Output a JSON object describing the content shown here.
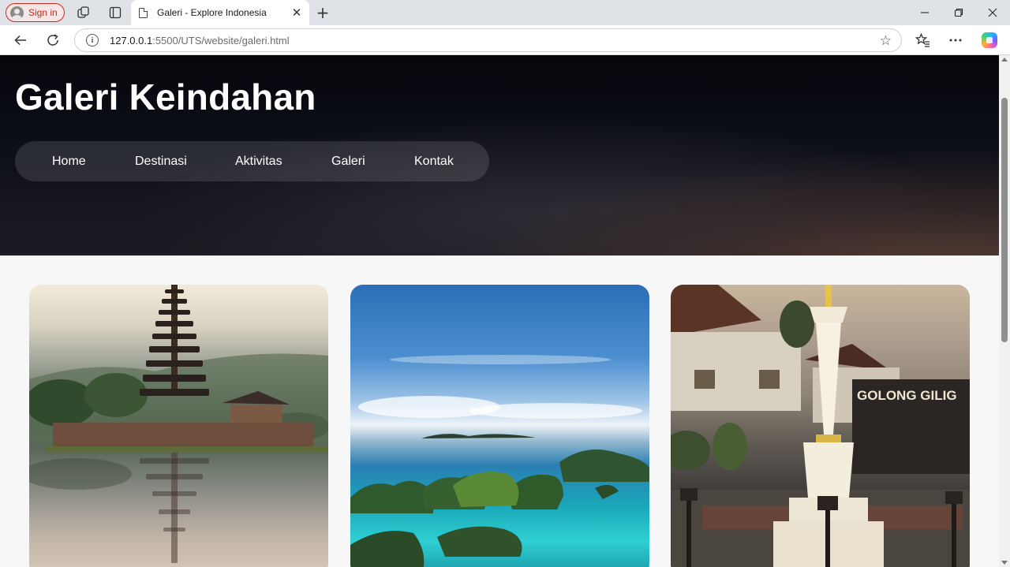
{
  "browser": {
    "signin_label": "Sign in",
    "tab_title": "Galeri - Explore Indonesia",
    "url_host": "127.0.0.1",
    "url_rest": ":5500/UTS/website/galeri.html"
  },
  "header": {
    "title": "Galeri Keindahan",
    "nav": [
      "Home",
      "Destinasi",
      "Aktivitas",
      "Galeri",
      "Kontak"
    ]
  },
  "gallery": {
    "items": [
      {
        "subject": "Bali temple on lake",
        "sign_text": ""
      },
      {
        "subject": "Raja Ampat islands",
        "sign_text": ""
      },
      {
        "subject": "Tugu Yogyakarta monument",
        "sign_text": "GOLONG GILIG"
      }
    ]
  },
  "colors": {
    "signin_accent": "#c42b1c",
    "hero_dark": "#0d0f18",
    "nav_text": "#ffffff"
  }
}
